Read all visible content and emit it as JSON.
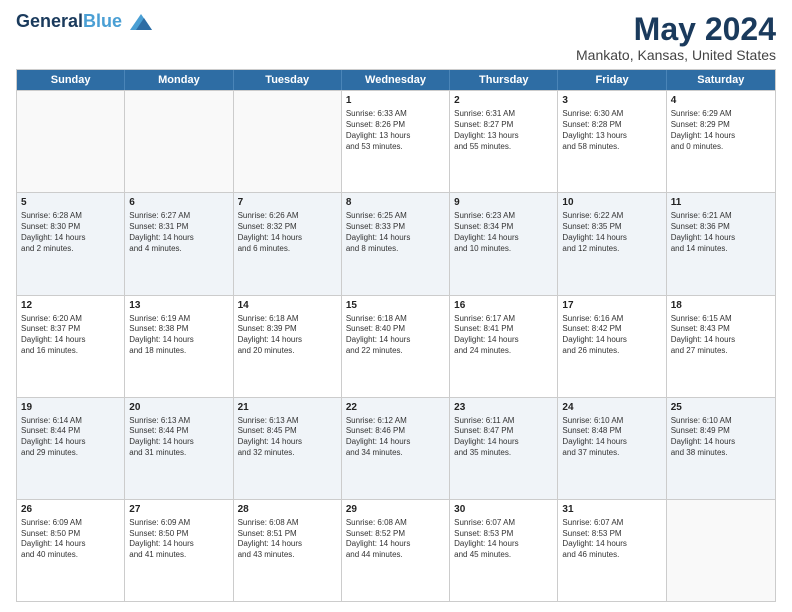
{
  "header": {
    "logo_line1": "General",
    "logo_line2": "Blue",
    "title": "May 2024",
    "subtitle": "Mankato, Kansas, United States"
  },
  "days_of_week": [
    "Sunday",
    "Monday",
    "Tuesday",
    "Wednesday",
    "Thursday",
    "Friday",
    "Saturday"
  ],
  "weeks": [
    {
      "alt": false,
      "cells": [
        {
          "day": "",
          "info": ""
        },
        {
          "day": "",
          "info": ""
        },
        {
          "day": "",
          "info": ""
        },
        {
          "day": "1",
          "info": "Sunrise: 6:33 AM\nSunset: 8:26 PM\nDaylight: 13 hours\nand 53 minutes."
        },
        {
          "day": "2",
          "info": "Sunrise: 6:31 AM\nSunset: 8:27 PM\nDaylight: 13 hours\nand 55 minutes."
        },
        {
          "day": "3",
          "info": "Sunrise: 6:30 AM\nSunset: 8:28 PM\nDaylight: 13 hours\nand 58 minutes."
        },
        {
          "day": "4",
          "info": "Sunrise: 6:29 AM\nSunset: 8:29 PM\nDaylight: 14 hours\nand 0 minutes."
        }
      ]
    },
    {
      "alt": true,
      "cells": [
        {
          "day": "5",
          "info": "Sunrise: 6:28 AM\nSunset: 8:30 PM\nDaylight: 14 hours\nand 2 minutes."
        },
        {
          "day": "6",
          "info": "Sunrise: 6:27 AM\nSunset: 8:31 PM\nDaylight: 14 hours\nand 4 minutes."
        },
        {
          "day": "7",
          "info": "Sunrise: 6:26 AM\nSunset: 8:32 PM\nDaylight: 14 hours\nand 6 minutes."
        },
        {
          "day": "8",
          "info": "Sunrise: 6:25 AM\nSunset: 8:33 PM\nDaylight: 14 hours\nand 8 minutes."
        },
        {
          "day": "9",
          "info": "Sunrise: 6:23 AM\nSunset: 8:34 PM\nDaylight: 14 hours\nand 10 minutes."
        },
        {
          "day": "10",
          "info": "Sunrise: 6:22 AM\nSunset: 8:35 PM\nDaylight: 14 hours\nand 12 minutes."
        },
        {
          "day": "11",
          "info": "Sunrise: 6:21 AM\nSunset: 8:36 PM\nDaylight: 14 hours\nand 14 minutes."
        }
      ]
    },
    {
      "alt": false,
      "cells": [
        {
          "day": "12",
          "info": "Sunrise: 6:20 AM\nSunset: 8:37 PM\nDaylight: 14 hours\nand 16 minutes."
        },
        {
          "day": "13",
          "info": "Sunrise: 6:19 AM\nSunset: 8:38 PM\nDaylight: 14 hours\nand 18 minutes."
        },
        {
          "day": "14",
          "info": "Sunrise: 6:18 AM\nSunset: 8:39 PM\nDaylight: 14 hours\nand 20 minutes."
        },
        {
          "day": "15",
          "info": "Sunrise: 6:18 AM\nSunset: 8:40 PM\nDaylight: 14 hours\nand 22 minutes."
        },
        {
          "day": "16",
          "info": "Sunrise: 6:17 AM\nSunset: 8:41 PM\nDaylight: 14 hours\nand 24 minutes."
        },
        {
          "day": "17",
          "info": "Sunrise: 6:16 AM\nSunset: 8:42 PM\nDaylight: 14 hours\nand 26 minutes."
        },
        {
          "day": "18",
          "info": "Sunrise: 6:15 AM\nSunset: 8:43 PM\nDaylight: 14 hours\nand 27 minutes."
        }
      ]
    },
    {
      "alt": true,
      "cells": [
        {
          "day": "19",
          "info": "Sunrise: 6:14 AM\nSunset: 8:44 PM\nDaylight: 14 hours\nand 29 minutes."
        },
        {
          "day": "20",
          "info": "Sunrise: 6:13 AM\nSunset: 8:44 PM\nDaylight: 14 hours\nand 31 minutes."
        },
        {
          "day": "21",
          "info": "Sunrise: 6:13 AM\nSunset: 8:45 PM\nDaylight: 14 hours\nand 32 minutes."
        },
        {
          "day": "22",
          "info": "Sunrise: 6:12 AM\nSunset: 8:46 PM\nDaylight: 14 hours\nand 34 minutes."
        },
        {
          "day": "23",
          "info": "Sunrise: 6:11 AM\nSunset: 8:47 PM\nDaylight: 14 hours\nand 35 minutes."
        },
        {
          "day": "24",
          "info": "Sunrise: 6:10 AM\nSunset: 8:48 PM\nDaylight: 14 hours\nand 37 minutes."
        },
        {
          "day": "25",
          "info": "Sunrise: 6:10 AM\nSunset: 8:49 PM\nDaylight: 14 hours\nand 38 minutes."
        }
      ]
    },
    {
      "alt": false,
      "cells": [
        {
          "day": "26",
          "info": "Sunrise: 6:09 AM\nSunset: 8:50 PM\nDaylight: 14 hours\nand 40 minutes."
        },
        {
          "day": "27",
          "info": "Sunrise: 6:09 AM\nSunset: 8:50 PM\nDaylight: 14 hours\nand 41 minutes."
        },
        {
          "day": "28",
          "info": "Sunrise: 6:08 AM\nSunset: 8:51 PM\nDaylight: 14 hours\nand 43 minutes."
        },
        {
          "day": "29",
          "info": "Sunrise: 6:08 AM\nSunset: 8:52 PM\nDaylight: 14 hours\nand 44 minutes."
        },
        {
          "day": "30",
          "info": "Sunrise: 6:07 AM\nSunset: 8:53 PM\nDaylight: 14 hours\nand 45 minutes."
        },
        {
          "day": "31",
          "info": "Sunrise: 6:07 AM\nSunset: 8:53 PM\nDaylight: 14 hours\nand 46 minutes."
        },
        {
          "day": "",
          "info": ""
        }
      ]
    }
  ]
}
